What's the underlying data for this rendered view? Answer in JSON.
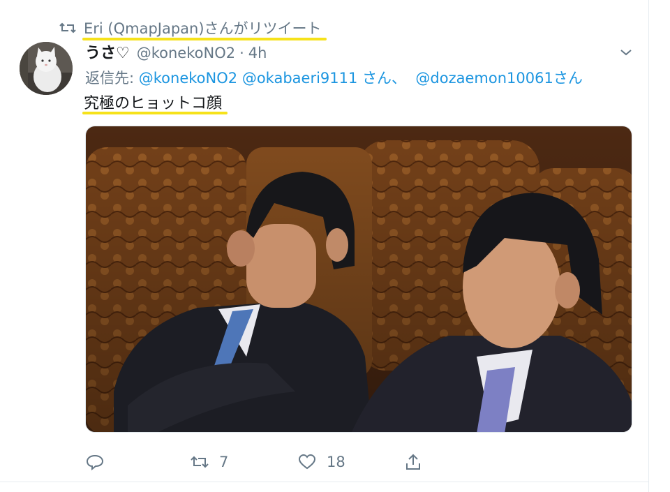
{
  "retweet": {
    "icon": "retweet-icon",
    "text": "Eri (QmapJapan)さんがリツイート"
  },
  "tweet": {
    "avatar": "cat-avatar",
    "name": "うさ♡",
    "handle": "@konekoNO2",
    "separator": "·",
    "time": "4h",
    "reply_to": {
      "prefix": "返信先:",
      "users": [
        "@konekoNO2",
        "@okabaeri9111",
        "@dozaemon10061"
      ],
      "joiner": " さん、",
      "suffix": "さん"
    },
    "text": "究極のヒョットコ顔",
    "image": "photo-two-men-seated"
  },
  "actions": {
    "reply": {
      "icon": "reply-icon",
      "count": ""
    },
    "retweet": {
      "icon": "retweet-icon",
      "count": "7"
    },
    "like": {
      "icon": "heart-icon",
      "count": "18"
    },
    "share": {
      "icon": "share-icon",
      "count": ""
    }
  },
  "colors": {
    "link": "#1b95e0",
    "muted": "#657786",
    "text": "#14171a",
    "highlight": "#f6e21a"
  }
}
